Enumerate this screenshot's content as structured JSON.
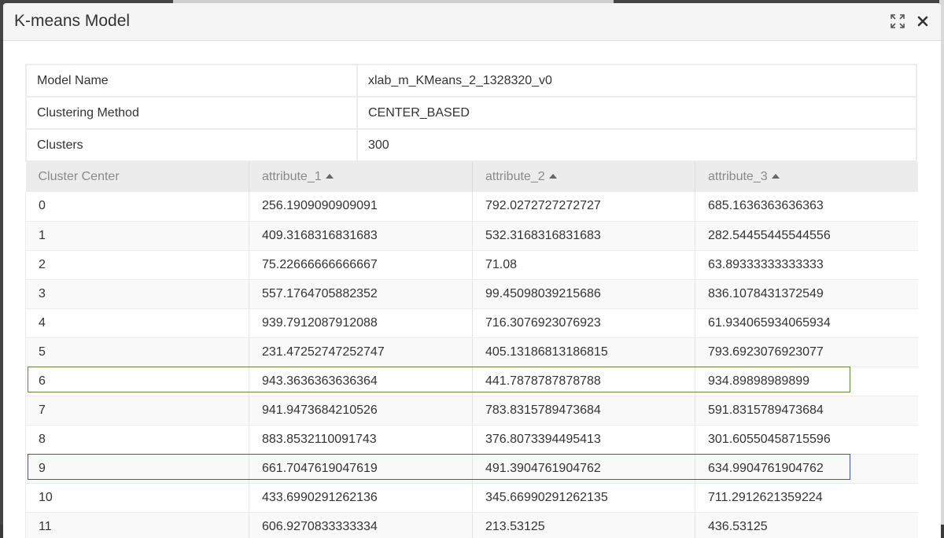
{
  "modal": {
    "title": "K-means Model",
    "expand_icon": "expand-icon",
    "close_icon": "close-icon"
  },
  "info": [
    {
      "label": "Model Name",
      "value": "xlab_m_KMeans_2_1328320_v0"
    },
    {
      "label": "Clustering Method",
      "value": "CENTER_BASED"
    },
    {
      "label": "Clusters",
      "value": "300"
    }
  ],
  "centers": {
    "headers": [
      "Cluster Center",
      "attribute_1",
      "attribute_2",
      "attribute_3"
    ],
    "rows": [
      [
        "0",
        "256.1909090909091",
        "792.0272727272727",
        "685.1636363636363"
      ],
      [
        "1",
        "409.3168316831683",
        "532.3168316831683",
        "282.54455445544556"
      ],
      [
        "2",
        "75.22666666666667",
        "71.08",
        "63.89333333333333"
      ],
      [
        "3",
        "557.1764705882352",
        "99.45098039215686",
        "836.1078431372549"
      ],
      [
        "4",
        "939.7912087912088",
        "716.3076923076923",
        "61.934065934065934"
      ],
      [
        "5",
        "231.47252747252747",
        "405.13186813186815",
        "793.6923076923077"
      ],
      [
        "6",
        "943.3636363636364",
        "441.7878787878788",
        "934.89898989899"
      ],
      [
        "7",
        "941.9473684210526",
        "783.8315789473684",
        "591.8315789473684"
      ],
      [
        "8",
        "883.8532110091743",
        "376.8073394495413",
        "301.60550458715596"
      ],
      [
        "9",
        "661.7047619047619",
        "491.3904761904762",
        "634.9904761904762"
      ],
      [
        "10",
        "433.6990291262136",
        "345.66990291262135",
        "711.2912621359224"
      ],
      [
        "11",
        "606.9270833333334",
        "213.53125",
        "436.53125"
      ]
    ]
  },
  "highlight_colors": {
    "green": "#5a8a3a",
    "blue": "#3a5a9a"
  }
}
